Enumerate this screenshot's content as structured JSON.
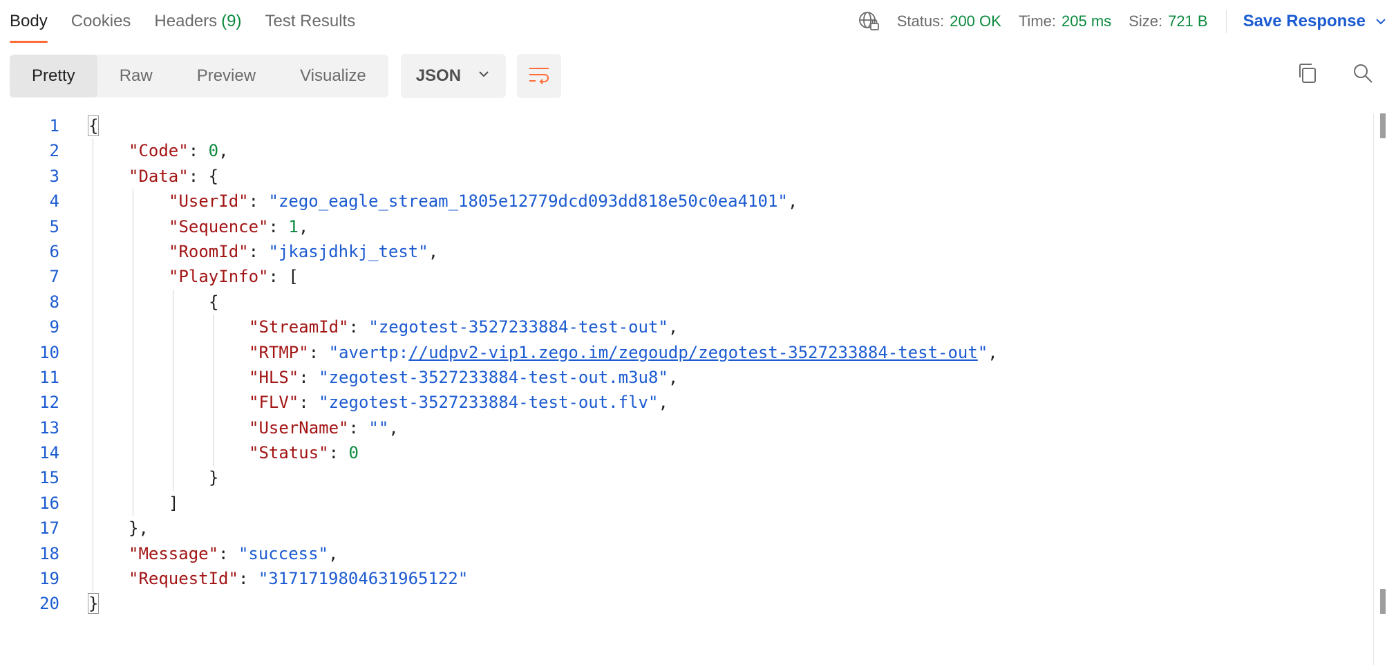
{
  "tabs": [
    {
      "label": "Body",
      "active": true
    },
    {
      "label": "Cookies"
    },
    {
      "label": "Headers",
      "count": "(9)"
    },
    {
      "label": "Test Results"
    }
  ],
  "status": {
    "status_label": "Status:",
    "status_value": "200 OK",
    "time_label": "Time:",
    "time_value": "205 ms",
    "size_label": "Size:",
    "size_value": "721 B"
  },
  "save_response_label": "Save Response",
  "view_modes": [
    "Pretty",
    "Raw",
    "Preview",
    "Visualize"
  ],
  "active_view_mode": "Pretty",
  "format": "JSON",
  "colors": {
    "accent": "#ff6c37",
    "status_green": "#0b8a3e",
    "link_blue": "#1c5bd1",
    "json_key": "#a31515",
    "json_string": "#1c5bd1",
    "json_number": "#0b8a3e"
  },
  "code_lines": [
    {
      "num": "1",
      "tokens": [
        {
          "t": "{",
          "c": "p"
        }
      ]
    },
    {
      "num": "2",
      "indent": 1,
      "tokens": [
        {
          "t": "\"Code\"",
          "c": "k"
        },
        {
          "t": ": ",
          "c": "p"
        },
        {
          "t": "0",
          "c": "n"
        },
        {
          "t": ",",
          "c": "p"
        }
      ]
    },
    {
      "num": "3",
      "indent": 1,
      "tokens": [
        {
          "t": "\"Data\"",
          "c": "k"
        },
        {
          "t": ": {",
          "c": "p"
        }
      ]
    },
    {
      "num": "4",
      "indent": 2,
      "tokens": [
        {
          "t": "\"UserId\"",
          "c": "k"
        },
        {
          "t": ": ",
          "c": "p"
        },
        {
          "t": "\"zego_eagle_stream_1805e12779dcd093dd818e50c0ea4101\"",
          "c": "s"
        },
        {
          "t": ",",
          "c": "p"
        }
      ]
    },
    {
      "num": "5",
      "indent": 2,
      "tokens": [
        {
          "t": "\"Sequence\"",
          "c": "k"
        },
        {
          "t": ": ",
          "c": "p"
        },
        {
          "t": "1",
          "c": "n"
        },
        {
          "t": ",",
          "c": "p"
        }
      ]
    },
    {
      "num": "6",
      "indent": 2,
      "tokens": [
        {
          "t": "\"RoomId\"",
          "c": "k"
        },
        {
          "t": ": ",
          "c": "p"
        },
        {
          "t": "\"jkasjdhkj_test\"",
          "c": "s"
        },
        {
          "t": ",",
          "c": "p"
        }
      ]
    },
    {
      "num": "7",
      "indent": 2,
      "tokens": [
        {
          "t": "\"PlayInfo\"",
          "c": "k"
        },
        {
          "t": ": [",
          "c": "p"
        }
      ]
    },
    {
      "num": "8",
      "indent": 3,
      "tokens": [
        {
          "t": "{",
          "c": "p"
        }
      ]
    },
    {
      "num": "9",
      "indent": 4,
      "tokens": [
        {
          "t": "\"StreamId\"",
          "c": "k"
        },
        {
          "t": ": ",
          "c": "p"
        },
        {
          "t": "\"zegotest-3527233884-test-out\"",
          "c": "s"
        },
        {
          "t": ",",
          "c": "p"
        }
      ]
    },
    {
      "num": "10",
      "indent": 4,
      "tokens": [
        {
          "t": "\"RTMP\"",
          "c": "k"
        },
        {
          "t": ": ",
          "c": "p"
        },
        {
          "t": "\"avertp:",
          "c": "s"
        },
        {
          "t": "//udpv2-vip1.zego.im/zegoudp/zegotest-3527233884-test-out",
          "c": "s link"
        },
        {
          "t": "\"",
          "c": "s"
        },
        {
          "t": ",",
          "c": "p"
        }
      ]
    },
    {
      "num": "11",
      "indent": 4,
      "tokens": [
        {
          "t": "\"HLS\"",
          "c": "k"
        },
        {
          "t": ": ",
          "c": "p"
        },
        {
          "t": "\"zegotest-3527233884-test-out.m3u8\"",
          "c": "s"
        },
        {
          "t": ",",
          "c": "p"
        }
      ]
    },
    {
      "num": "12",
      "indent": 4,
      "tokens": [
        {
          "t": "\"FLV\"",
          "c": "k"
        },
        {
          "t": ": ",
          "c": "p"
        },
        {
          "t": "\"zegotest-3527233884-test-out.flv\"",
          "c": "s"
        },
        {
          "t": ",",
          "c": "p"
        }
      ]
    },
    {
      "num": "13",
      "indent": 4,
      "tokens": [
        {
          "t": "\"UserName\"",
          "c": "k"
        },
        {
          "t": ": ",
          "c": "p"
        },
        {
          "t": "\"\"",
          "c": "s"
        },
        {
          "t": ",",
          "c": "p"
        }
      ]
    },
    {
      "num": "14",
      "indent": 4,
      "tokens": [
        {
          "t": "\"Status\"",
          "c": "k"
        },
        {
          "t": ": ",
          "c": "p"
        },
        {
          "t": "0",
          "c": "n"
        }
      ]
    },
    {
      "num": "15",
      "indent": 3,
      "tokens": [
        {
          "t": "}",
          "c": "p"
        }
      ]
    },
    {
      "num": "16",
      "indent": 2,
      "tokens": [
        {
          "t": "]",
          "c": "p"
        }
      ]
    },
    {
      "num": "17",
      "indent": 1,
      "tokens": [
        {
          "t": "},",
          "c": "p"
        }
      ]
    },
    {
      "num": "18",
      "indent": 1,
      "tokens": [
        {
          "t": "\"Message\"",
          "c": "k"
        },
        {
          "t": ": ",
          "c": "p"
        },
        {
          "t": "\"success\"",
          "c": "s"
        },
        {
          "t": ",",
          "c": "p"
        }
      ]
    },
    {
      "num": "19",
      "indent": 1,
      "tokens": [
        {
          "t": "\"RequestId\"",
          "c": "k"
        },
        {
          "t": ": ",
          "c": "p"
        },
        {
          "t": "\"3171719804631965122\"",
          "c": "s"
        }
      ]
    },
    {
      "num": "20",
      "tokens": [
        {
          "t": "}",
          "c": "p"
        }
      ]
    }
  ]
}
